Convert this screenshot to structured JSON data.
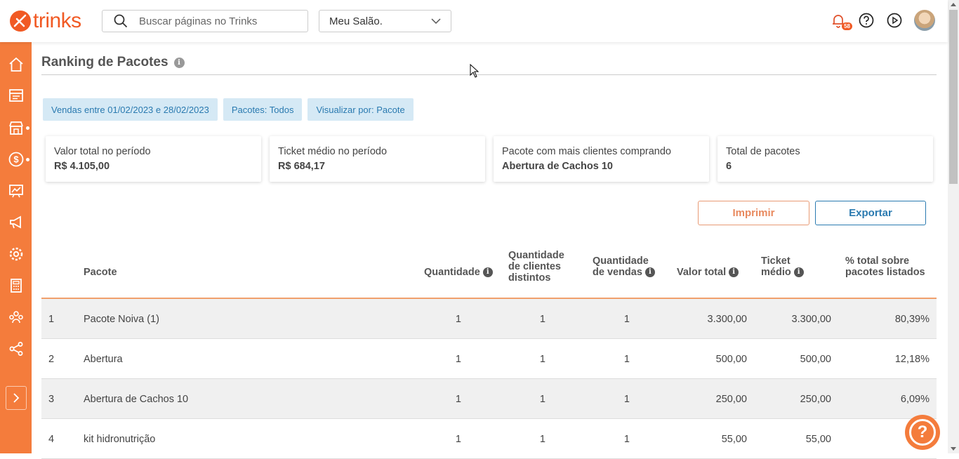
{
  "app": {
    "logo_text": "trinks"
  },
  "search": {
    "placeholder": "Buscar páginas no Trinks"
  },
  "salon_selector": {
    "value": "Meu Salão."
  },
  "header_icons": {
    "notification_badge": "58",
    "icons": [
      "bell-icon",
      "help-circle-icon",
      "play-circle-icon",
      "avatar"
    ]
  },
  "sidebar": {
    "items": [
      "home-icon",
      "schedule-icon",
      "store-icon",
      "finance-icon",
      "reports-icon",
      "marketing-icon",
      "settings-icon",
      "calculator-icon",
      "clients-icon",
      "share-icon"
    ],
    "expand_icon": "chevron-right-icon"
  },
  "page": {
    "title": "Ranking de Pacotes"
  },
  "filters": [
    "Vendas entre 01/02/2023 e 28/02/2023",
    "Pacotes: Todos",
    "Visualizar por: Pacote"
  ],
  "summary_cards": [
    {
      "label": "Valor total no período",
      "value": "R$ 4.105,00"
    },
    {
      "label": "Ticket médio no período",
      "value": "R$ 684,17"
    },
    {
      "label": "Pacote com mais clientes comprando",
      "value": "Abertura de Cachos 10"
    },
    {
      "label": "Total de pacotes",
      "value": "6"
    }
  ],
  "actions": {
    "print_label": "Imprimir",
    "export_label": "Exportar"
  },
  "table": {
    "headers": {
      "pacote": "Pacote",
      "quantidade": "Quantidade",
      "clientes_l1": "Quantidade",
      "clientes_l2": "de clientes",
      "clientes_l3": "distintos",
      "vendas_l1": "Quantidade",
      "vendas_l2": "de vendas",
      "valor_total": "Valor total",
      "ticket_l1": "Ticket",
      "ticket_l2": "médio",
      "pct_l1": "% total sobre",
      "pct_l2": "pacotes listados"
    },
    "rows": [
      {
        "rank": "1",
        "pacote": "Pacote Noiva (1)",
        "quantidade": "1",
        "clientes": "1",
        "vendas": "1",
        "valor_total": "3.300,00",
        "ticket": "3.300,00",
        "pct": "80,39%"
      },
      {
        "rank": "2",
        "pacote": "Abertura",
        "quantidade": "1",
        "clientes": "1",
        "vendas": "1",
        "valor_total": "500,00",
        "ticket": "500,00",
        "pct": "12,18%"
      },
      {
        "rank": "3",
        "pacote": "Abertura de Cachos 10",
        "quantidade": "1",
        "clientes": "1",
        "vendas": "1",
        "valor_total": "250,00",
        "ticket": "250,00",
        "pct": "6,09%"
      },
      {
        "rank": "4",
        "pacote": "kit hidronutrição",
        "quantidade": "1",
        "clientes": "1",
        "vendas": "1",
        "valor_total": "55,00",
        "ticket": "55,00",
        "pct": "1"
      }
    ]
  },
  "help_button": {
    "label": "?"
  },
  "colors": {
    "brand_orange": "#f47c3c",
    "link_blue": "#2a7ab0",
    "chip_bg": "#d5e9f5"
  }
}
